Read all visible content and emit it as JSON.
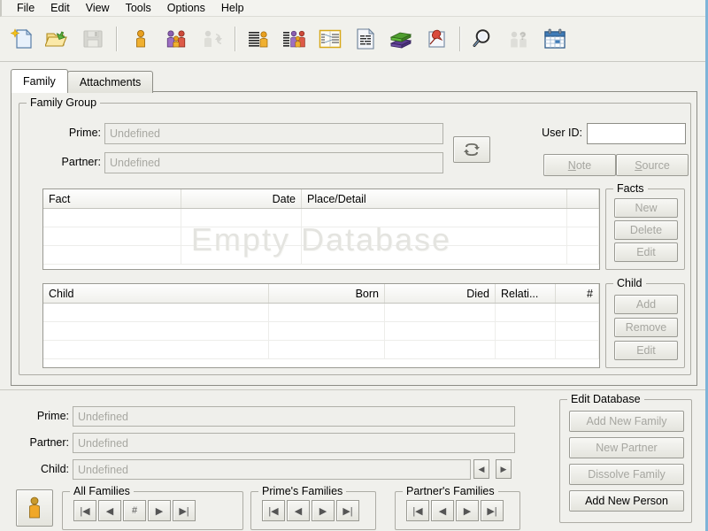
{
  "menubar": {
    "items": [
      {
        "label": "File"
      },
      {
        "label": "Edit"
      },
      {
        "label": "View"
      },
      {
        "label": "Tools"
      },
      {
        "label": "Options"
      },
      {
        "label": "Help"
      }
    ]
  },
  "toolbar": {
    "buttons": [
      {
        "icon": "new-document-icon",
        "enabled": true
      },
      {
        "icon": "open-folder-icon",
        "enabled": true
      },
      {
        "icon": "save-disk-icon",
        "enabled": false
      },
      {
        "icon": "separator",
        "enabled": false
      },
      {
        "icon": "person-icon",
        "enabled": true
      },
      {
        "icon": "family-group-icon",
        "enabled": true
      },
      {
        "icon": "person-swap-icon",
        "enabled": false
      },
      {
        "icon": "separator",
        "enabled": false
      },
      {
        "icon": "person-list-icon",
        "enabled": true
      },
      {
        "icon": "family-list-icon",
        "enabled": true
      },
      {
        "icon": "pedigree-chart-icon",
        "enabled": true
      },
      {
        "icon": "report-document-icon",
        "enabled": true
      },
      {
        "icon": "books-icon",
        "enabled": true
      },
      {
        "icon": "pin-note-icon",
        "enabled": true
      },
      {
        "icon": "separator",
        "enabled": false
      },
      {
        "icon": "search-magnifier-icon",
        "enabled": true
      },
      {
        "icon": "unknown-people-icon",
        "enabled": false
      },
      {
        "icon": "calendar-icon",
        "enabled": true
      }
    ]
  },
  "tabs": [
    {
      "label": "Family",
      "active": true
    },
    {
      "label": "Attachments",
      "active": false
    }
  ],
  "family_group": {
    "title": "Family Group",
    "prime_label": "Prime:",
    "prime_value": "Undefined",
    "partner_label": "Partner:",
    "partner_value": "Undefined",
    "swap_icon": "swap-arrows-icon",
    "user_id_label": "User ID:",
    "user_id_value": "",
    "note_button": "Note",
    "note_mnemonic": "N",
    "source_button": "Source",
    "source_mnemonic": "S"
  },
  "facts_grid": {
    "columns": [
      "Fact",
      "Date",
      "Place/Detail",
      ""
    ],
    "rows": [],
    "watermark": "Empty Database"
  },
  "children_grid": {
    "columns": [
      "Child",
      "Born",
      "Died",
      "Relati...",
      "#"
    ],
    "rows": []
  },
  "facts_panel": {
    "title": "Facts",
    "buttons": [
      {
        "label": "New",
        "enabled": false
      },
      {
        "label": "Delete",
        "enabled": false
      },
      {
        "label": "Edit",
        "enabled": false
      }
    ]
  },
  "child_panel": {
    "title": "Child",
    "buttons": [
      {
        "label": "Add",
        "enabled": false
      },
      {
        "label": "Remove",
        "enabled": false
      },
      {
        "label": "Edit",
        "enabled": false
      }
    ]
  },
  "bottom": {
    "prime_label": "Prime:",
    "prime_value": "Undefined",
    "partner_label": "Partner:",
    "partner_value": "Undefined",
    "child_label": "Child:",
    "child_value": "Undefined",
    "person_icon": "person-figure-icon",
    "nav_groups": [
      {
        "title": "All Families",
        "buttons": [
          {
            "glyph": "|◀",
            "name": "first"
          },
          {
            "glyph": "◀",
            "name": "previous"
          },
          {
            "glyph": "#",
            "name": "goto-number"
          },
          {
            "glyph": "▶",
            "name": "next"
          },
          {
            "glyph": "▶|",
            "name": "last"
          }
        ]
      },
      {
        "title": "Prime's Families",
        "buttons": [
          {
            "glyph": "|◀",
            "name": "first"
          },
          {
            "glyph": "◀",
            "name": "previous"
          },
          {
            "glyph": "▶",
            "name": "next"
          },
          {
            "glyph": "▶|",
            "name": "last"
          }
        ]
      },
      {
        "title": "Partner's Families",
        "buttons": [
          {
            "glyph": "|◀",
            "name": "first"
          },
          {
            "glyph": "◀",
            "name": "previous"
          },
          {
            "glyph": "▶",
            "name": "next"
          },
          {
            "glyph": "▶|",
            "name": "last"
          }
        ]
      }
    ],
    "edit_database": {
      "title": "Edit Database",
      "buttons": [
        {
          "label": "Add New Family",
          "enabled": false
        },
        {
          "label": "New Partner",
          "enabled": false
        },
        {
          "label": "Dissolve Family",
          "enabled": false
        },
        {
          "label": "Add New Person",
          "enabled": true
        }
      ]
    }
  },
  "colors": {
    "window_face": "#f0f0ec",
    "frame_blue": "#7fb4d8",
    "disabled_text": "#a6a6a0",
    "watermark": "#e4e4e0",
    "accent_orange": "#f0a028"
  }
}
